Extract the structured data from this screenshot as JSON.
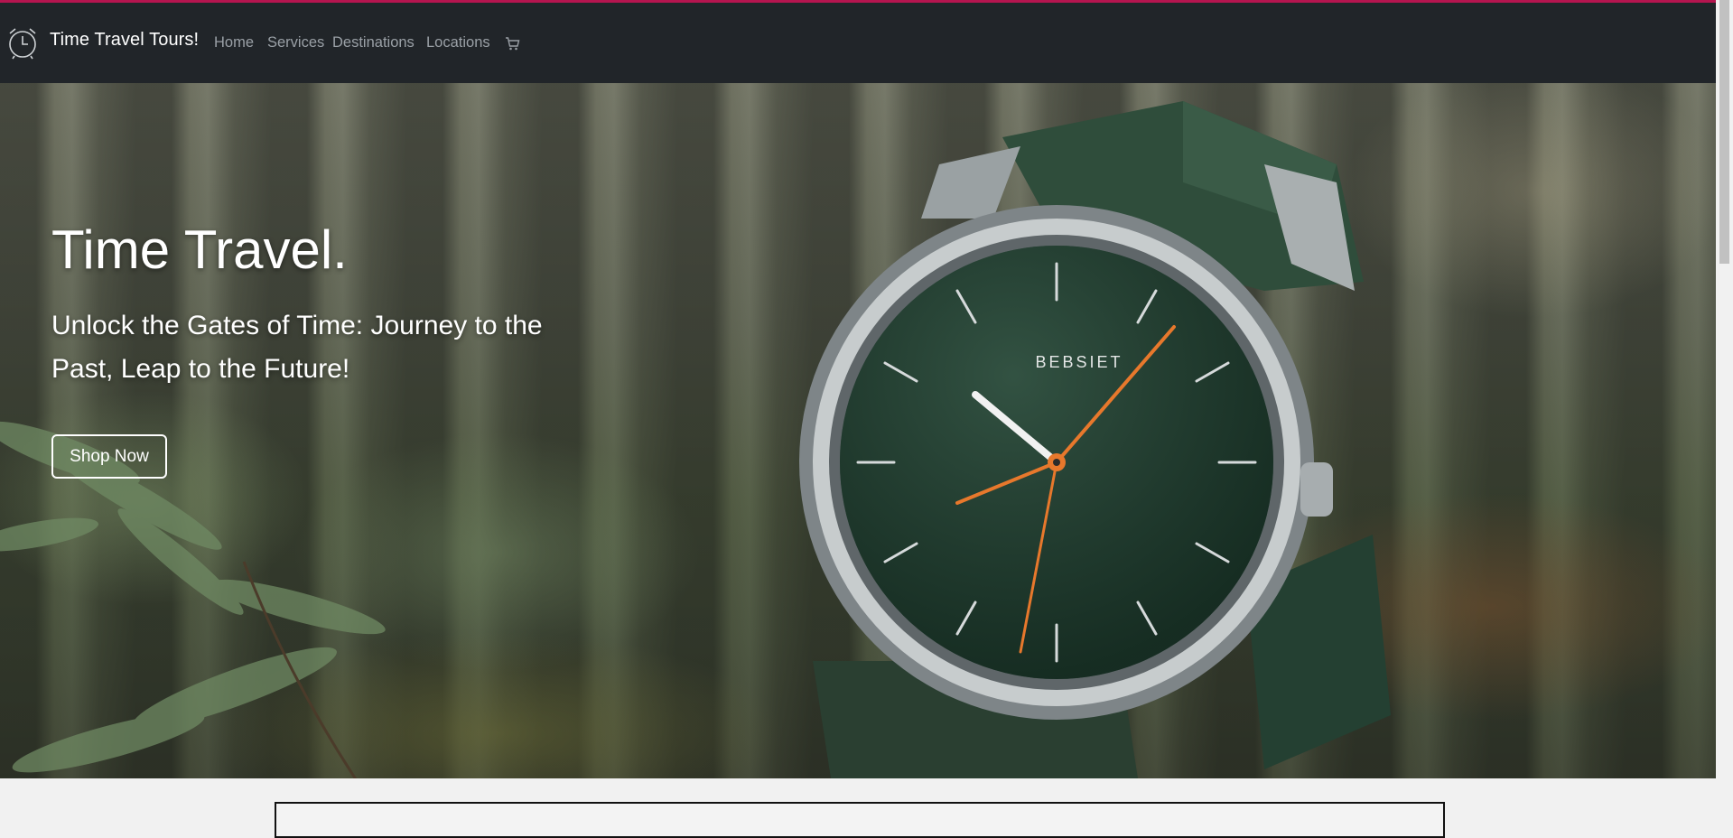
{
  "header": {
    "brand": "Time Travel Tours!",
    "nav": [
      {
        "label": "Home"
      },
      {
        "label": "Services"
      },
      {
        "label": "Destinations"
      },
      {
        "label": "Locations"
      }
    ],
    "cart_icon": "cart-icon",
    "logo_icon": "alarm-clock-icon"
  },
  "hero": {
    "title": "Time Travel.",
    "subtitle": "Unlock the Gates of Time: Journey to the Past, Leap to the Future!",
    "cta_label": "Shop Now",
    "watch_brand": "BEBSIET"
  },
  "colors": {
    "accent": "#b5154f",
    "navbar": "#212529",
    "nav_link": "#9aa0a6",
    "watch_dial": "#1f3b2e",
    "watch_hand_accent": "#e7782c"
  }
}
